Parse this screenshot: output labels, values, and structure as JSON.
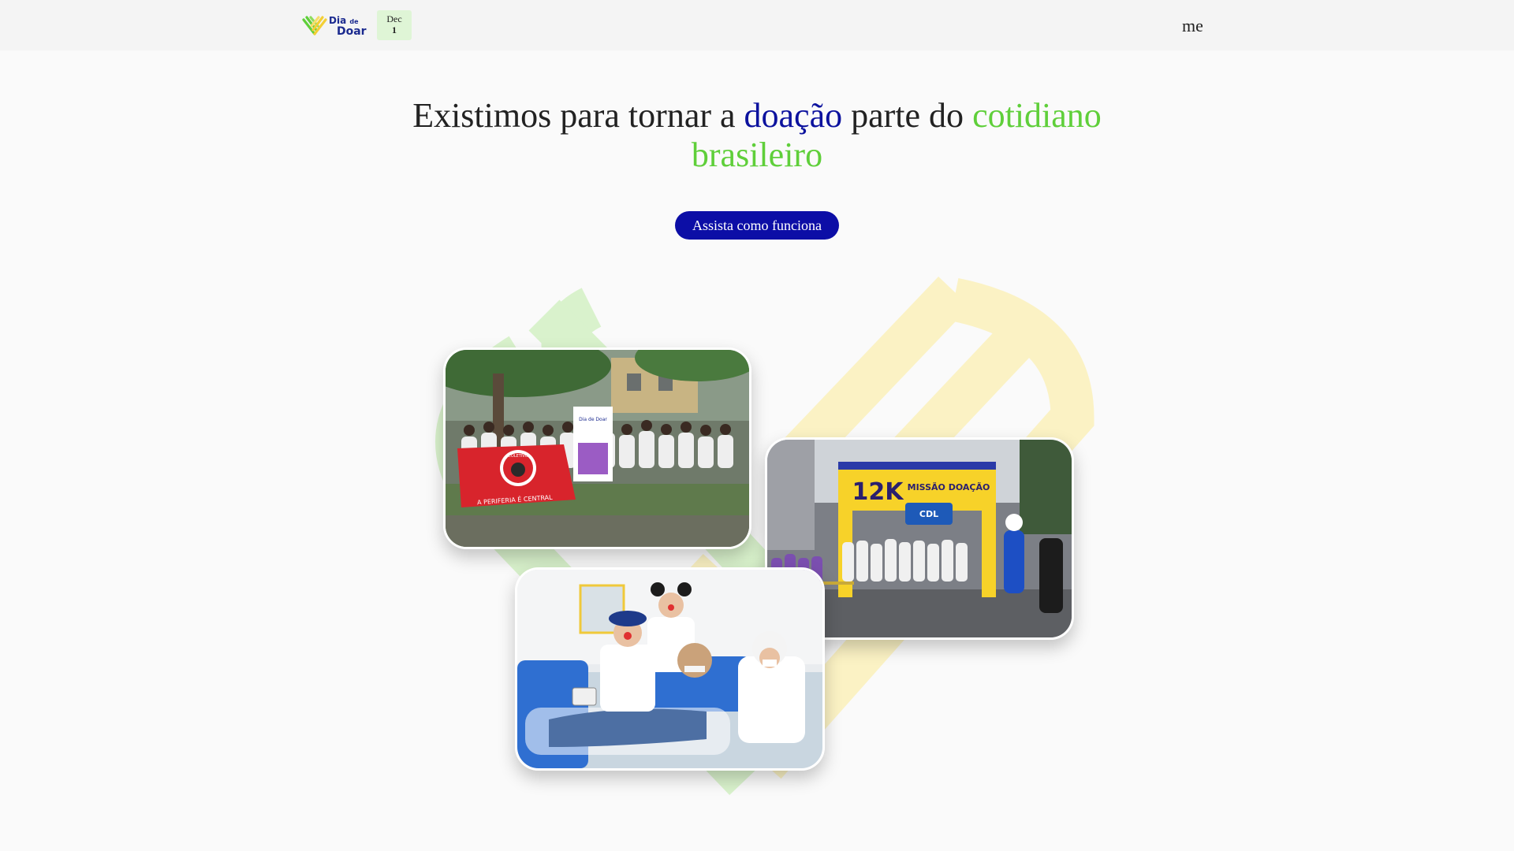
{
  "header": {
    "logo": {
      "line1": "Dia",
      "line1_small": "de",
      "line2": "Doar"
    },
    "date_badge": {
      "month": "Dec",
      "day": "1"
    },
    "menu_label": "menu"
  },
  "hero": {
    "title_part1": "Existimos para tornar a ",
    "title_highlight_blue": "doação",
    "title_part2": " parte do ",
    "title_highlight_green": "cotidiano brasileiro",
    "cta_label": "Assista como funciona"
  },
  "photos": {
    "photo1": {
      "banner_text": "A PERIFERIA É CENTRAL",
      "emblem_text": "COLETIVO",
      "sign_text": "Dia de Doar"
    },
    "photo2": {
      "arch_text_big": "12K",
      "arch_text_small": "MISSÃO DOAÇÃO",
      "sponsor_text": "CDL"
    }
  },
  "colors": {
    "accent_blue": "#0c129e",
    "accent_green": "#5fcf3a",
    "cta_bg": "#0c0ea6",
    "header_bg": "#f4f4f4",
    "date_badge_bg": "#dff5d6",
    "art_green": "#d9f2cc",
    "art_yellow": "#fbf2c4"
  },
  "icons": {
    "logo_mark": "heart-stripes-icon"
  }
}
